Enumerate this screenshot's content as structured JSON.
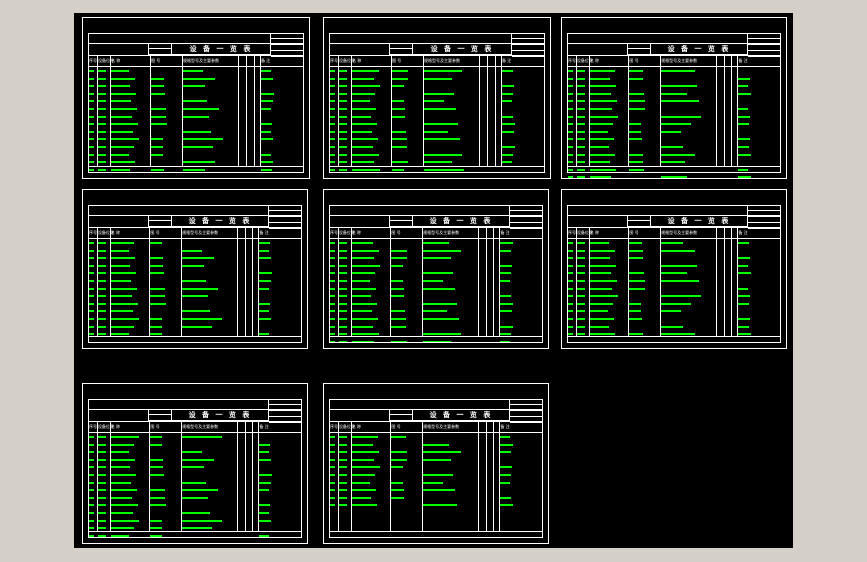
{
  "sheet_template": {
    "doc_title": "设 备 一 览 表",
    "columns": [
      "序号",
      "设备位号",
      "名 称",
      "图 号",
      "规格型号及主要参数",
      "备 注"
    ]
  },
  "colors": {
    "background": "#000000",
    "frame": "#ffffff",
    "text_green": "#00ff00",
    "chrome": "#d4d0c8"
  },
  "sheets": [
    {
      "id": "sheet-1",
      "rows": 14
    },
    {
      "id": "sheet-2",
      "rows": 14
    },
    {
      "id": "sheet-3",
      "rows": 15
    },
    {
      "id": "sheet-4",
      "rows": 13
    },
    {
      "id": "sheet-5",
      "rows": 14
    },
    {
      "id": "sheet-6",
      "rows": 13
    },
    {
      "id": "sheet-7",
      "rows": 14
    },
    {
      "id": "sheet-8",
      "rows": 10
    }
  ]
}
